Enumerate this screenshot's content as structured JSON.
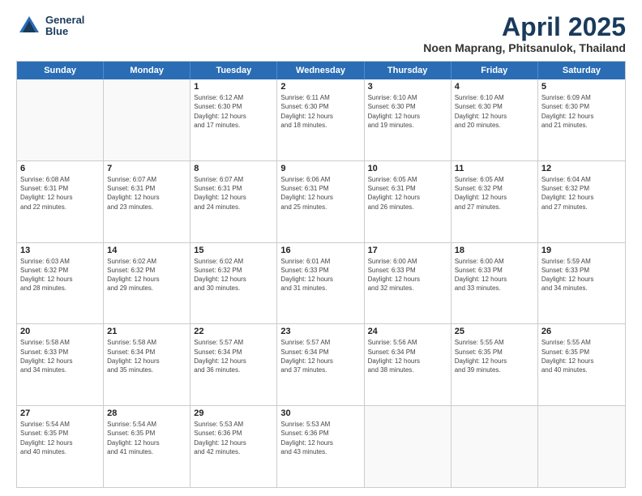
{
  "header": {
    "logo_line1": "General",
    "logo_line2": "Blue",
    "title": "April 2025",
    "subtitle": "Noen Maprang, Phitsanulok, Thailand"
  },
  "weekdays": [
    "Sunday",
    "Monday",
    "Tuesday",
    "Wednesday",
    "Thursday",
    "Friday",
    "Saturday"
  ],
  "weeks": [
    [
      {
        "day": "",
        "info": ""
      },
      {
        "day": "",
        "info": ""
      },
      {
        "day": "1",
        "info": "Sunrise: 6:12 AM\nSunset: 6:30 PM\nDaylight: 12 hours\nand 17 minutes."
      },
      {
        "day": "2",
        "info": "Sunrise: 6:11 AM\nSunset: 6:30 PM\nDaylight: 12 hours\nand 18 minutes."
      },
      {
        "day": "3",
        "info": "Sunrise: 6:10 AM\nSunset: 6:30 PM\nDaylight: 12 hours\nand 19 minutes."
      },
      {
        "day": "4",
        "info": "Sunrise: 6:10 AM\nSunset: 6:30 PM\nDaylight: 12 hours\nand 20 minutes."
      },
      {
        "day": "5",
        "info": "Sunrise: 6:09 AM\nSunset: 6:30 PM\nDaylight: 12 hours\nand 21 minutes."
      }
    ],
    [
      {
        "day": "6",
        "info": "Sunrise: 6:08 AM\nSunset: 6:31 PM\nDaylight: 12 hours\nand 22 minutes."
      },
      {
        "day": "7",
        "info": "Sunrise: 6:07 AM\nSunset: 6:31 PM\nDaylight: 12 hours\nand 23 minutes."
      },
      {
        "day": "8",
        "info": "Sunrise: 6:07 AM\nSunset: 6:31 PM\nDaylight: 12 hours\nand 24 minutes."
      },
      {
        "day": "9",
        "info": "Sunrise: 6:06 AM\nSunset: 6:31 PM\nDaylight: 12 hours\nand 25 minutes."
      },
      {
        "day": "10",
        "info": "Sunrise: 6:05 AM\nSunset: 6:31 PM\nDaylight: 12 hours\nand 26 minutes."
      },
      {
        "day": "11",
        "info": "Sunrise: 6:05 AM\nSunset: 6:32 PM\nDaylight: 12 hours\nand 27 minutes."
      },
      {
        "day": "12",
        "info": "Sunrise: 6:04 AM\nSunset: 6:32 PM\nDaylight: 12 hours\nand 27 minutes."
      }
    ],
    [
      {
        "day": "13",
        "info": "Sunrise: 6:03 AM\nSunset: 6:32 PM\nDaylight: 12 hours\nand 28 minutes."
      },
      {
        "day": "14",
        "info": "Sunrise: 6:02 AM\nSunset: 6:32 PM\nDaylight: 12 hours\nand 29 minutes."
      },
      {
        "day": "15",
        "info": "Sunrise: 6:02 AM\nSunset: 6:32 PM\nDaylight: 12 hours\nand 30 minutes."
      },
      {
        "day": "16",
        "info": "Sunrise: 6:01 AM\nSunset: 6:33 PM\nDaylight: 12 hours\nand 31 minutes."
      },
      {
        "day": "17",
        "info": "Sunrise: 6:00 AM\nSunset: 6:33 PM\nDaylight: 12 hours\nand 32 minutes."
      },
      {
        "day": "18",
        "info": "Sunrise: 6:00 AM\nSunset: 6:33 PM\nDaylight: 12 hours\nand 33 minutes."
      },
      {
        "day": "19",
        "info": "Sunrise: 5:59 AM\nSunset: 6:33 PM\nDaylight: 12 hours\nand 34 minutes."
      }
    ],
    [
      {
        "day": "20",
        "info": "Sunrise: 5:58 AM\nSunset: 6:33 PM\nDaylight: 12 hours\nand 34 minutes."
      },
      {
        "day": "21",
        "info": "Sunrise: 5:58 AM\nSunset: 6:34 PM\nDaylight: 12 hours\nand 35 minutes."
      },
      {
        "day": "22",
        "info": "Sunrise: 5:57 AM\nSunset: 6:34 PM\nDaylight: 12 hours\nand 36 minutes."
      },
      {
        "day": "23",
        "info": "Sunrise: 5:57 AM\nSunset: 6:34 PM\nDaylight: 12 hours\nand 37 minutes."
      },
      {
        "day": "24",
        "info": "Sunrise: 5:56 AM\nSunset: 6:34 PM\nDaylight: 12 hours\nand 38 minutes."
      },
      {
        "day": "25",
        "info": "Sunrise: 5:55 AM\nSunset: 6:35 PM\nDaylight: 12 hours\nand 39 minutes."
      },
      {
        "day": "26",
        "info": "Sunrise: 5:55 AM\nSunset: 6:35 PM\nDaylight: 12 hours\nand 40 minutes."
      }
    ],
    [
      {
        "day": "27",
        "info": "Sunrise: 5:54 AM\nSunset: 6:35 PM\nDaylight: 12 hours\nand 40 minutes."
      },
      {
        "day": "28",
        "info": "Sunrise: 5:54 AM\nSunset: 6:35 PM\nDaylight: 12 hours\nand 41 minutes."
      },
      {
        "day": "29",
        "info": "Sunrise: 5:53 AM\nSunset: 6:36 PM\nDaylight: 12 hours\nand 42 minutes."
      },
      {
        "day": "30",
        "info": "Sunrise: 5:53 AM\nSunset: 6:36 PM\nDaylight: 12 hours\nand 43 minutes."
      },
      {
        "day": "",
        "info": ""
      },
      {
        "day": "",
        "info": ""
      },
      {
        "day": "",
        "info": ""
      }
    ]
  ]
}
